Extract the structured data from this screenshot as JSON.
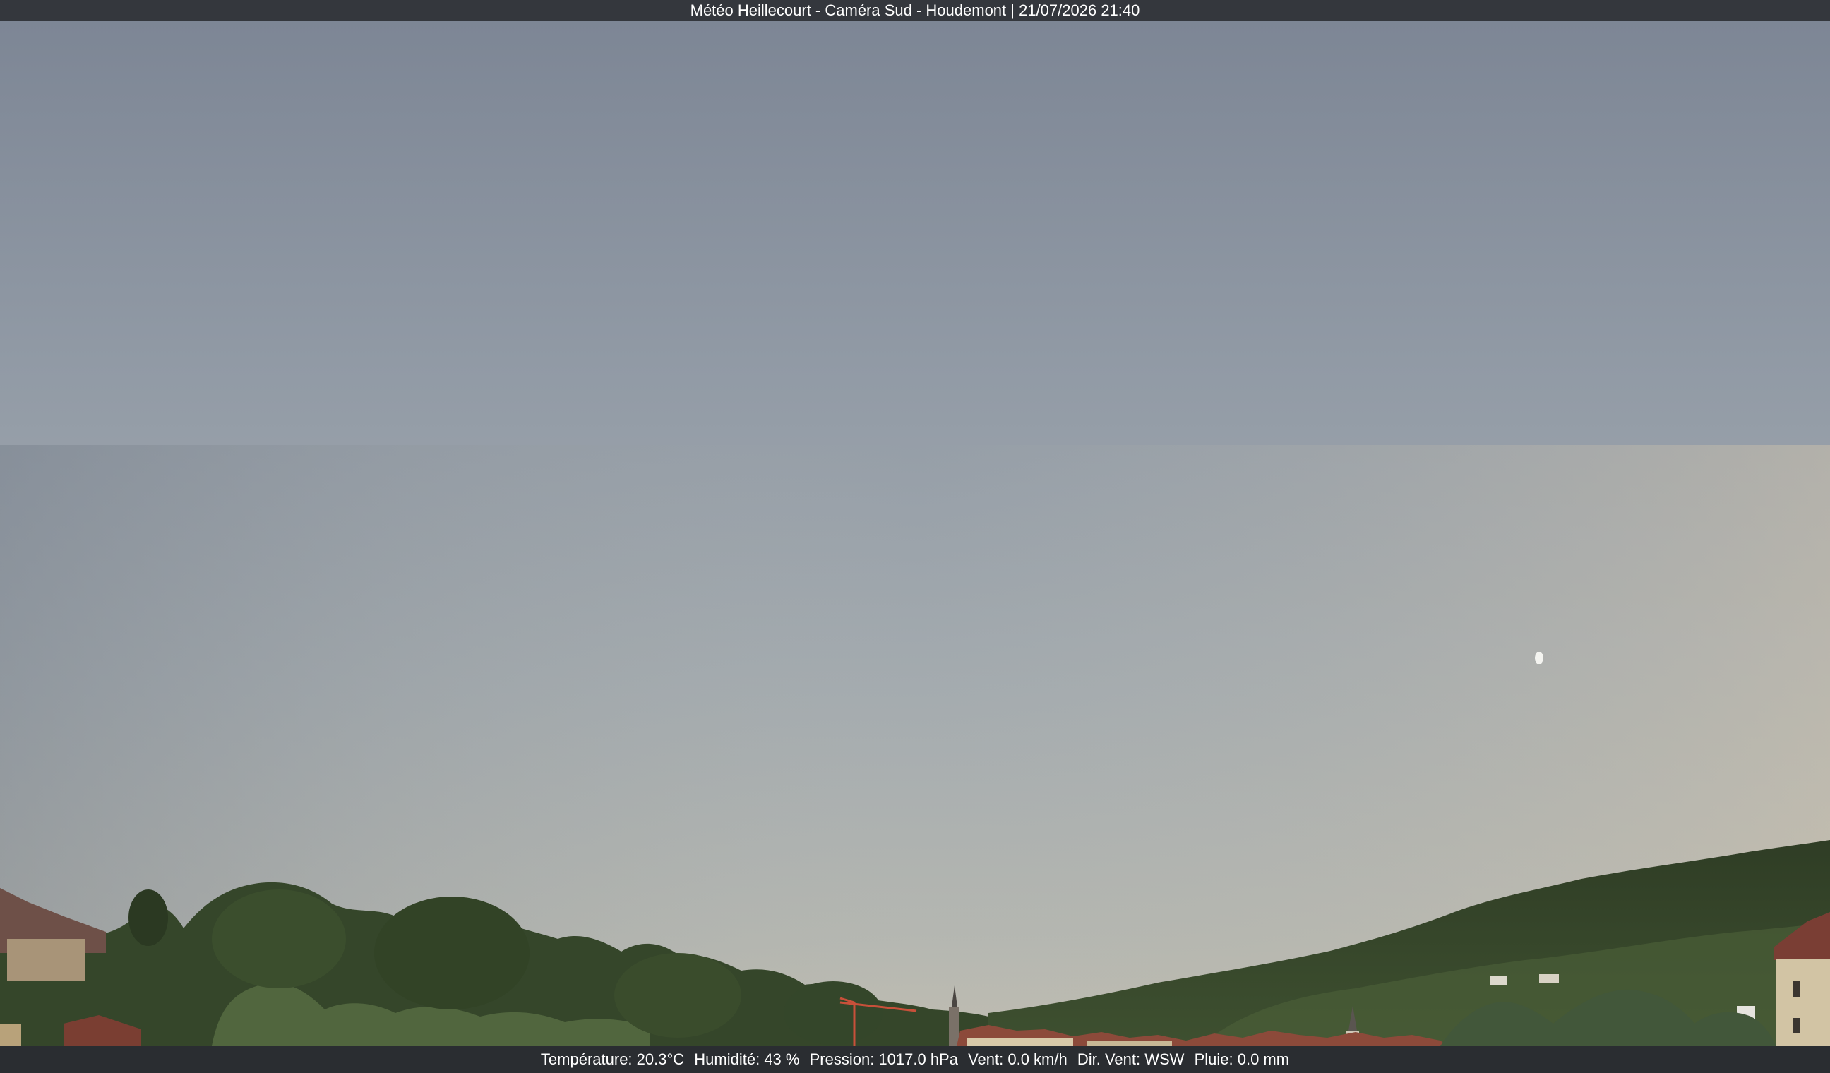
{
  "header": {
    "title": "Météo Heillecourt - Caméra Sud - Houdemont | 21/07/2026 21:40"
  },
  "weather": {
    "temperature": "Température: 20.3°C",
    "humidity": "Humidité: 43 %",
    "pressure": "Pression: 1017.0 hPa",
    "wind": "Vent: 0.0 km/h",
    "wind_direction": "Dir. Vent: WSW",
    "rain": "Pluie: 0.0 mm"
  },
  "colors": {
    "sky_top": "#7f8896",
    "sky_mid": "#a5acaf",
    "sky_horizon": "#c4c0b2",
    "foliage_dark": "#2c3a22",
    "foliage_mid": "#3f5230",
    "foliage_light": "#5d7448",
    "roof": "#8a4a3c",
    "crane": "#c8503a",
    "bar": "#34373d"
  }
}
